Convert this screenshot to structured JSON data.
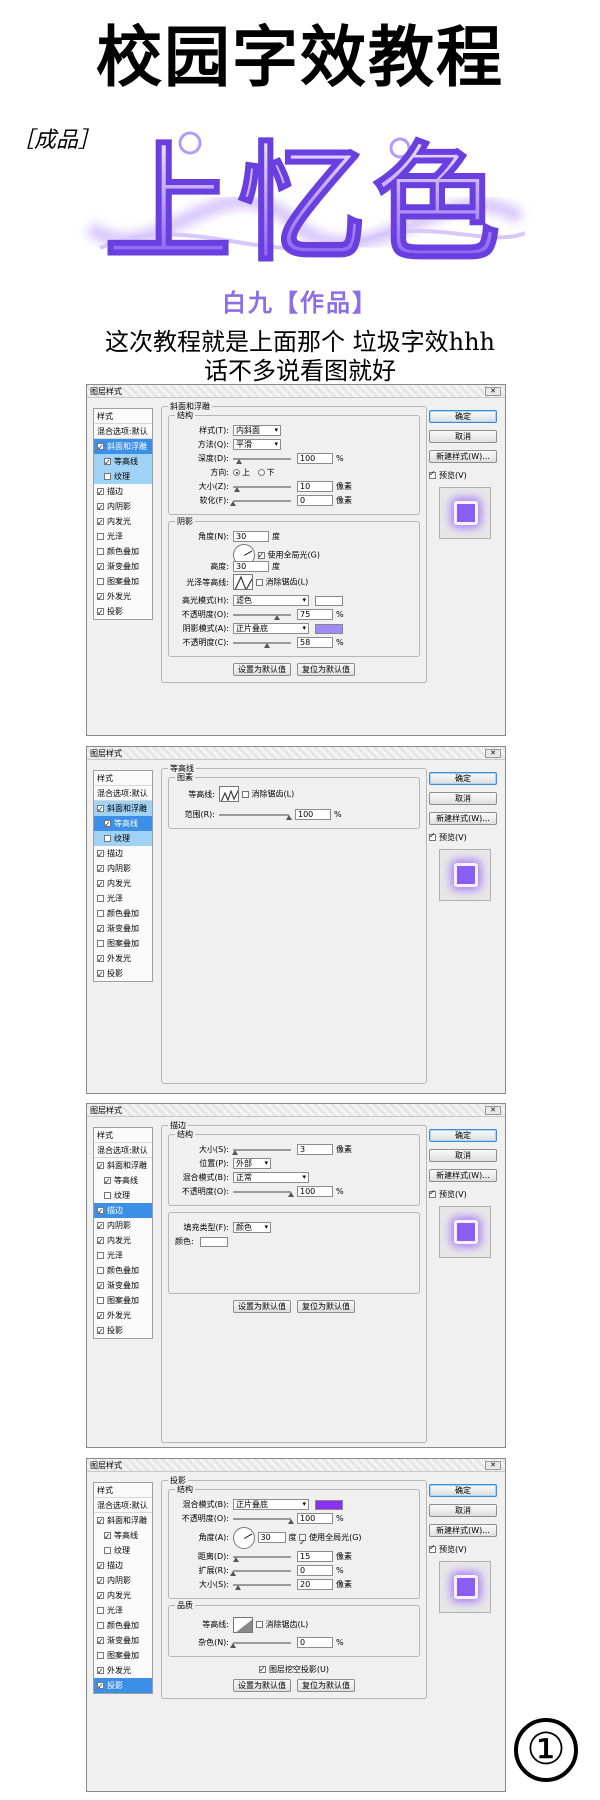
{
  "header": {
    "title": "校园字效教程",
    "chengpin": "［成品］",
    "logo_text": "上忆色",
    "author": "白九【作品】",
    "intro_line1": "这次教程就是上面那个 垃圾字效hhh",
    "intro_line2": "话不多说看图就好"
  },
  "common": {
    "dialog_title": "图层样式",
    "close_icon": "close-icon",
    "styles_header": "样式",
    "blend_default": "混合选项:默认",
    "ok": "确定",
    "cancel": "取消",
    "new_style": "新建样式(W)...",
    "preview": "预览(V)",
    "set_default": "设置为默认值",
    "reset_default": "复位为默认值",
    "styles": [
      "斜面和浮雕",
      "等高线",
      "纹理",
      "描边",
      "内阴影",
      "内发光",
      "光泽",
      "颜色叠加",
      "渐变叠加",
      "图案叠加",
      "外发光",
      "投影"
    ],
    "accent_color": "#3b8fe6",
    "purple": "#8a5ef5",
    "shadow_purple": "#8a30f0"
  },
  "bevel": {
    "section": "斜面和浮雕",
    "structure": "结构",
    "style_label": "样式(T):",
    "style_value": "内斜面",
    "method_label": "方法(Q):",
    "method_value": "平滑",
    "depth_label": "深度(D):",
    "depth_value": "100",
    "depth_unit": "%",
    "depth_level": 0.1,
    "direction_label": "方向:",
    "dir_up": "上",
    "dir_down": "下",
    "size_label": "大小(Z):",
    "size_value": "10",
    "size_unit": "像素",
    "size_level": 0.07,
    "soften_label": "软化(F):",
    "soften_value": "0",
    "soften_unit": "像素",
    "soften_level": 0,
    "shading": "阴影",
    "angle_label": "角度(N):",
    "angle_value": "30",
    "angle_unit": "度",
    "global_light": "使用全局光(G)",
    "altitude_label": "高度:",
    "altitude_value": "30",
    "altitude_unit": "度",
    "gloss_label": "光泽等高线:",
    "antialias": "消除锯齿(L)",
    "hl_mode_label": "高光模式(H):",
    "hl_mode_value": "滤色",
    "hl_opacity_label": "不透明度(O):",
    "hl_opacity_value": "75",
    "hl_opacity_unit": "%",
    "hl_opacity_level": 0.75,
    "hl_color": "#ffffff",
    "sh_mode_label": "阴影模式(A):",
    "sh_mode_value": "正片叠底",
    "sh_opacity_label": "不透明度(C):",
    "sh_opacity_value": "58",
    "sh_opacity_unit": "%",
    "sh_opacity_level": 0.58,
    "sh_color": "#a08af5"
  },
  "contour": {
    "section": "等高线",
    "element": "图素",
    "contour_label": "等高线:",
    "antialias": "消除锯齿(L)",
    "range_label": "范围(R):",
    "range_value": "100",
    "range_unit": "%",
    "range_level": 1
  },
  "stroke": {
    "section": "描边",
    "structure": "结构",
    "size_label": "大小(S):",
    "size_value": "3",
    "size_unit": "像素",
    "size_level": 0.03,
    "position_label": "位置(P):",
    "position_value": "外部",
    "blend_label": "混合模式(B):",
    "blend_value": "正常",
    "opacity_label": "不透明度(O):",
    "opacity_value": "100",
    "opacity_unit": "%",
    "opacity_level": 1,
    "fill_label": "填充类型(F):",
    "fill_value": "颜色",
    "color_label": "颜色:",
    "color": "#ffffff"
  },
  "shadow": {
    "section": "投影",
    "structure": "结构",
    "blend_label": "混合模式(B):",
    "blend_value": "正片叠底",
    "color": "#8a30f0",
    "opacity_label": "不透明度(O):",
    "opacity_value": "100",
    "opacity_unit": "%",
    "opacity_level": 1,
    "angle_label": "角度(A):",
    "angle_value": "30",
    "angle_unit": "度",
    "global_light": "使用全局光(G)",
    "distance_label": "距离(D):",
    "distance_value": "15",
    "distance_unit": "像素",
    "distance_level": 0.05,
    "spread_label": "扩展(R):",
    "spread_value": "0",
    "spread_unit": "%",
    "spread_level": 0,
    "size_label": "大小(S):",
    "size_value": "20",
    "size_unit": "像素",
    "size_level": 0.08,
    "quality": "品质",
    "contour_label": "等高线:",
    "antialias": "消除锯齿(L)",
    "noise_label": "杂色(N):",
    "noise_value": "0",
    "noise_unit": "%",
    "noise_level": 0,
    "knockout": "图层挖空投影(U)"
  },
  "footer": {
    "step_number": "①"
  }
}
